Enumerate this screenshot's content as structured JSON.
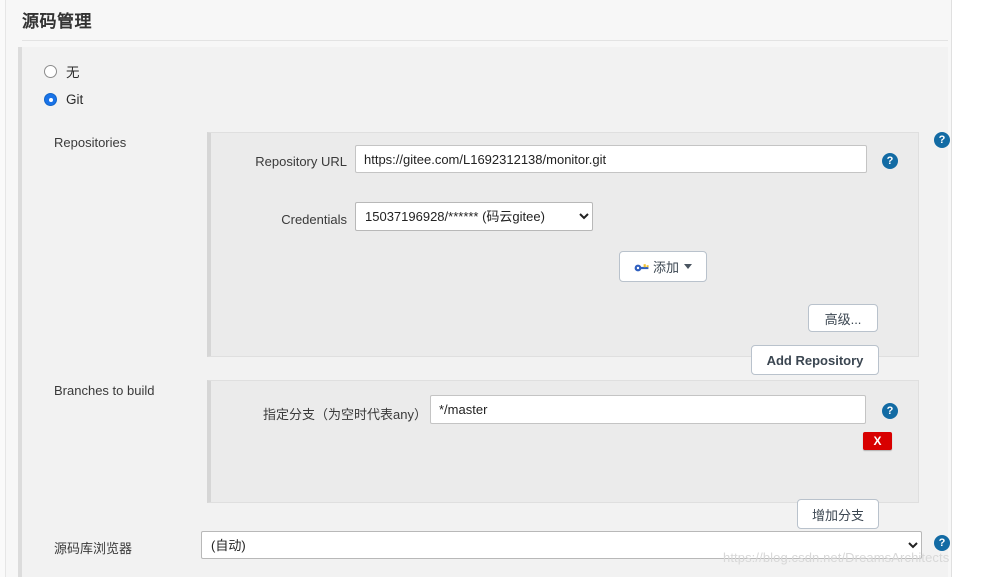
{
  "page": {
    "section_title": "源码管理",
    "watermark": "https://blog.csdn.net/DreamsArchitects"
  },
  "scm_options": [
    {
      "label": "无",
      "checked": false,
      "name": "scm-none"
    },
    {
      "label": "Git",
      "checked": true,
      "name": "scm-git"
    }
  ],
  "repositories": {
    "section_label": "Repositories",
    "repository_url": {
      "label": "Repository URL",
      "value": "https://gitee.com/L1692312138/monitor.git"
    },
    "credentials": {
      "label": "Credentials",
      "selected": "15037196928/****** (码云gitee)",
      "add_button": "添加",
      "add_icon": "key-icon"
    },
    "advanced_button": "高级...",
    "add_repository_button": "Add Repository"
  },
  "branches": {
    "section_label": "Branches to build",
    "branch_specifier": {
      "label": "指定分支（为空时代表any）",
      "value": "*/master"
    },
    "delete_button": "X",
    "add_branch_button": "增加分支"
  },
  "repository_browser": {
    "label": "源码库浏览器",
    "selected": "(自动)"
  },
  "help": {
    "glyph": "?"
  },
  "colors": {
    "accent_blue": "#1a73e8",
    "help_blue": "#136ba4",
    "danger_red": "#d80000",
    "panel_grey": "#ebebeb",
    "form_grey": "#f2f2f2"
  }
}
